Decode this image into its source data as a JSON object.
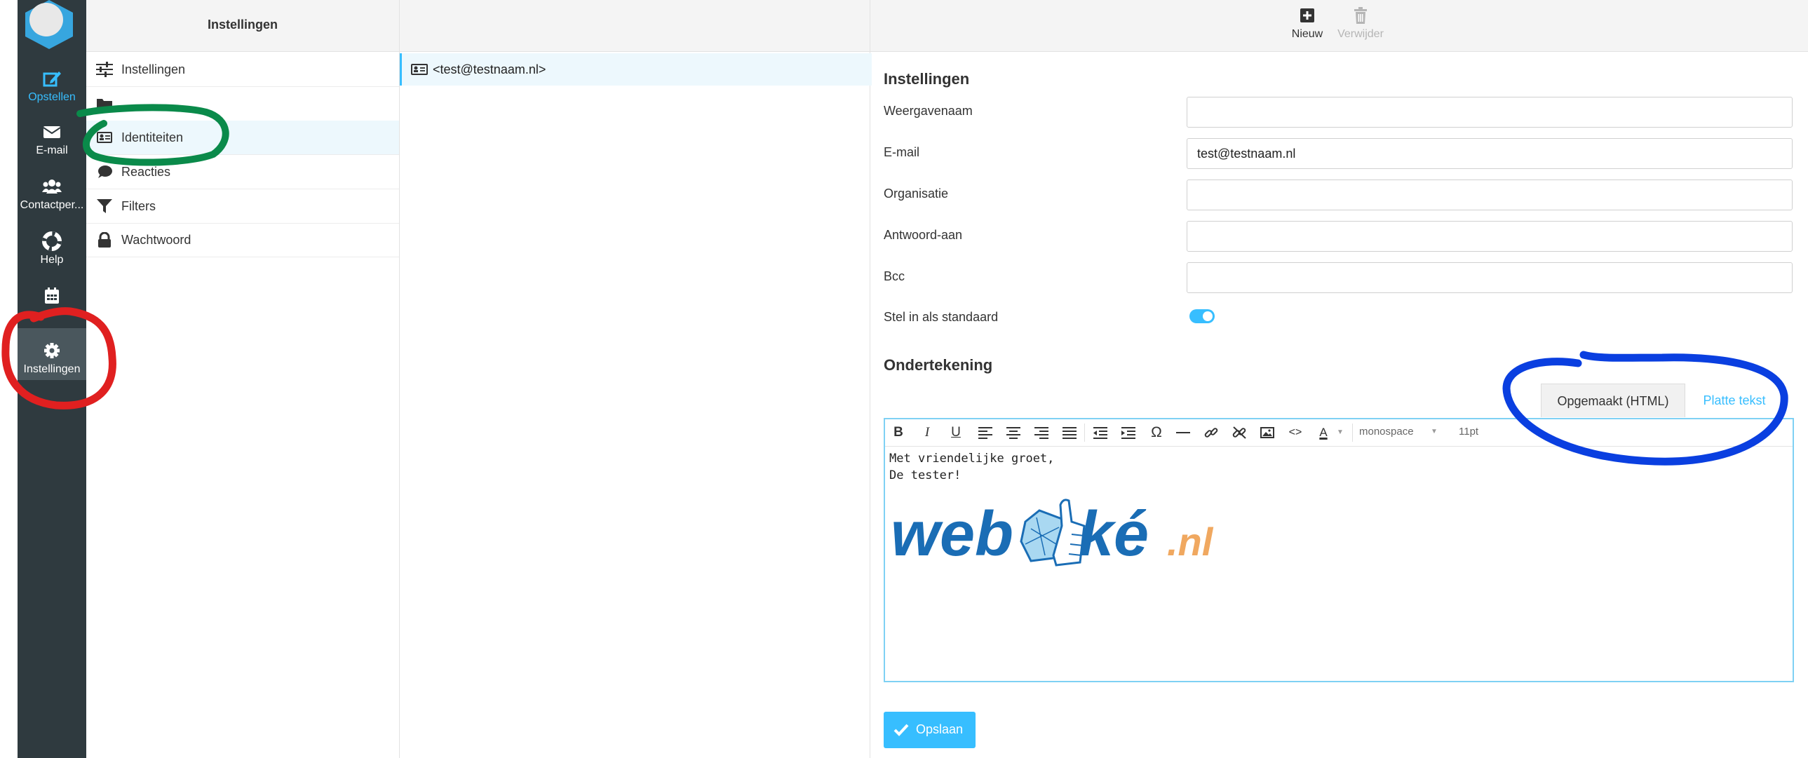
{
  "nav": {
    "items": [
      {
        "label": "Opstellen"
      },
      {
        "label": "E-mail"
      },
      {
        "label": "Contactper..."
      },
      {
        "label": "Help"
      },
      {
        "label": ""
      },
      {
        "label": "Instellingen"
      }
    ]
  },
  "settings": {
    "title": "Instellingen",
    "items": [
      {
        "label": "Instellingen"
      },
      {
        "label": ""
      },
      {
        "label": "Identiteiten"
      },
      {
        "label": "Reacties"
      },
      {
        "label": "Filters"
      },
      {
        "label": "Wachtwoord"
      }
    ]
  },
  "identities": {
    "rows": [
      {
        "label": "<test@testnaam.nl>"
      }
    ]
  },
  "toolbar": {
    "new_label": "Nieuw",
    "delete_label": "Verwijder"
  },
  "form": {
    "section_title": "Instellingen",
    "fields": [
      {
        "label": "Weergavenaam",
        "value": ""
      },
      {
        "label": "E-mail",
        "value": "test@testnaam.nl"
      },
      {
        "label": "Organisatie",
        "value": ""
      },
      {
        "label": "Antwoord-aan",
        "value": ""
      },
      {
        "label": "Bcc",
        "value": ""
      }
    ],
    "default_label": "Stel in als standaard",
    "default_enabled": true
  },
  "signature": {
    "title": "Ondertekening",
    "tab_html": "Opgemaakt (HTML)",
    "tab_plain": "Platte tekst",
    "font_family": "monospace",
    "font_size": "11pt",
    "body_text": "Met vriendelijke groet,\nDe tester!",
    "logo_web": "web",
    "logo_ke": "ké",
    "logo_nl": ".nl"
  },
  "save_label": "Opslaan",
  "colors": {
    "accent": "#37beff",
    "nav_bg": "#2f3a3f",
    "logo_blue": "#1a6db5",
    "logo_orange": "#f0a860",
    "annot_red": "#e02020",
    "annot_green": "#0a8a4a",
    "annot_blue": "#0a3fe0"
  }
}
